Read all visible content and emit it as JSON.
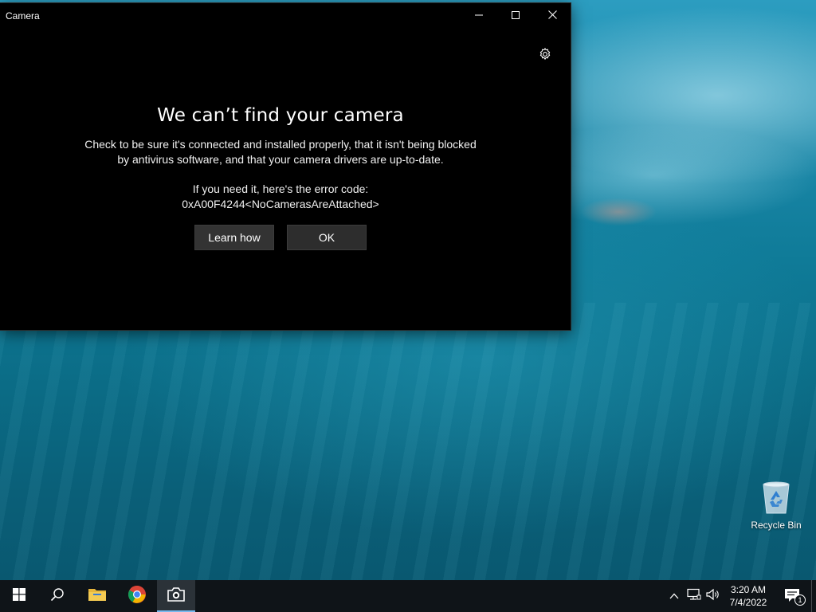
{
  "window": {
    "title": "Camera",
    "headline": "We can’t find your camera",
    "description_line1": "Check to be sure it's connected and installed properly, that it isn't being blocked",
    "description_line2": "by antivirus software, and that your camera drivers are up-to-date.",
    "error_intro": "If you need it, here's the error code:",
    "error_code": "0xA00F4244<NoCamerasAreAttached>",
    "buttons": {
      "learn_how": "Learn how",
      "ok": "OK"
    },
    "icons": {
      "minimize": "minimize-icon",
      "maximize": "maximize-icon",
      "close": "close-icon",
      "settings": "gear-icon"
    }
  },
  "desktop": {
    "icons": [
      {
        "label": "Recycle Bin",
        "icon": "recycle-bin-icon"
      }
    ]
  },
  "taskbar": {
    "items": [
      {
        "name": "start-button",
        "icon": "windows-logo-icon"
      },
      {
        "name": "search-button",
        "icon": "search-icon"
      },
      {
        "name": "file-explorer",
        "icon": "folder-icon"
      },
      {
        "name": "chrome",
        "icon": "chrome-icon"
      },
      {
        "name": "camera-app",
        "icon": "camera-icon",
        "active": true
      }
    ],
    "tray": {
      "icons": [
        "chevron-up-icon",
        "network-icon",
        "volume-icon"
      ],
      "time": "3:20 AM",
      "date": "7/4/2022",
      "notification_count": "1"
    }
  },
  "colors": {
    "window_bg": "#000000",
    "button_bg": "#333333",
    "taskbar_bg": "#0f1418",
    "accent": "#76b9ed"
  }
}
